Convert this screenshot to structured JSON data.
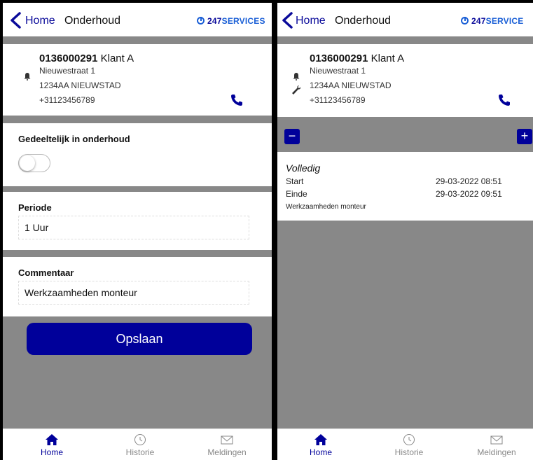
{
  "left": {
    "header": {
      "home_label": "Home",
      "title": "Onderhoud",
      "brand_prefix": "247",
      "brand_suffix": "SERVICES"
    },
    "customer": {
      "number": "0136000291",
      "name": "Klant A",
      "street": "Nieuwestraat 1",
      "zip_city": "1234AA NIEUWSTAD",
      "phone": "+31123456789"
    },
    "partial_maintenance": {
      "label": "Gedeeltelijk in onderhoud",
      "enabled": false
    },
    "period": {
      "label": "Periode",
      "value": "1 Uur"
    },
    "comment": {
      "label": "Commentaar",
      "value": "Werkzaamheden monteur"
    },
    "save_label": "Opslaan"
  },
  "right": {
    "header": {
      "home_label": "Home",
      "title": "Onderhoud",
      "brand_prefix": "247",
      "brand_suffix": "SERVICE"
    },
    "customer": {
      "number": "0136000291",
      "name": "Klant A",
      "street": "Nieuwestraat 1",
      "zip_city": "1234AA NIEUWSTAD",
      "phone": "+31123456789"
    },
    "controls": {
      "minus": "−",
      "plus": "+"
    },
    "history_item": {
      "type": "Volledig",
      "start_label": "Start",
      "start_value": "29-03-2022 08:51",
      "end_label": "Einde",
      "end_value": "29-03-2022 09:51",
      "note": "Werkzaamheden monteur"
    }
  },
  "tabbar": {
    "home": "Home",
    "history": "Historie",
    "notifications": "Meldingen",
    "active": "home"
  },
  "colors": {
    "brand_blue": "#00009a",
    "accent_blue": "#1a5fd6",
    "panel_grey": "#888888"
  },
  "icons": [
    "back-chevron-icon",
    "logo-icon",
    "bell-icon",
    "wrench-icon",
    "phone-icon",
    "home-icon",
    "history-icon",
    "mail-icon"
  ]
}
